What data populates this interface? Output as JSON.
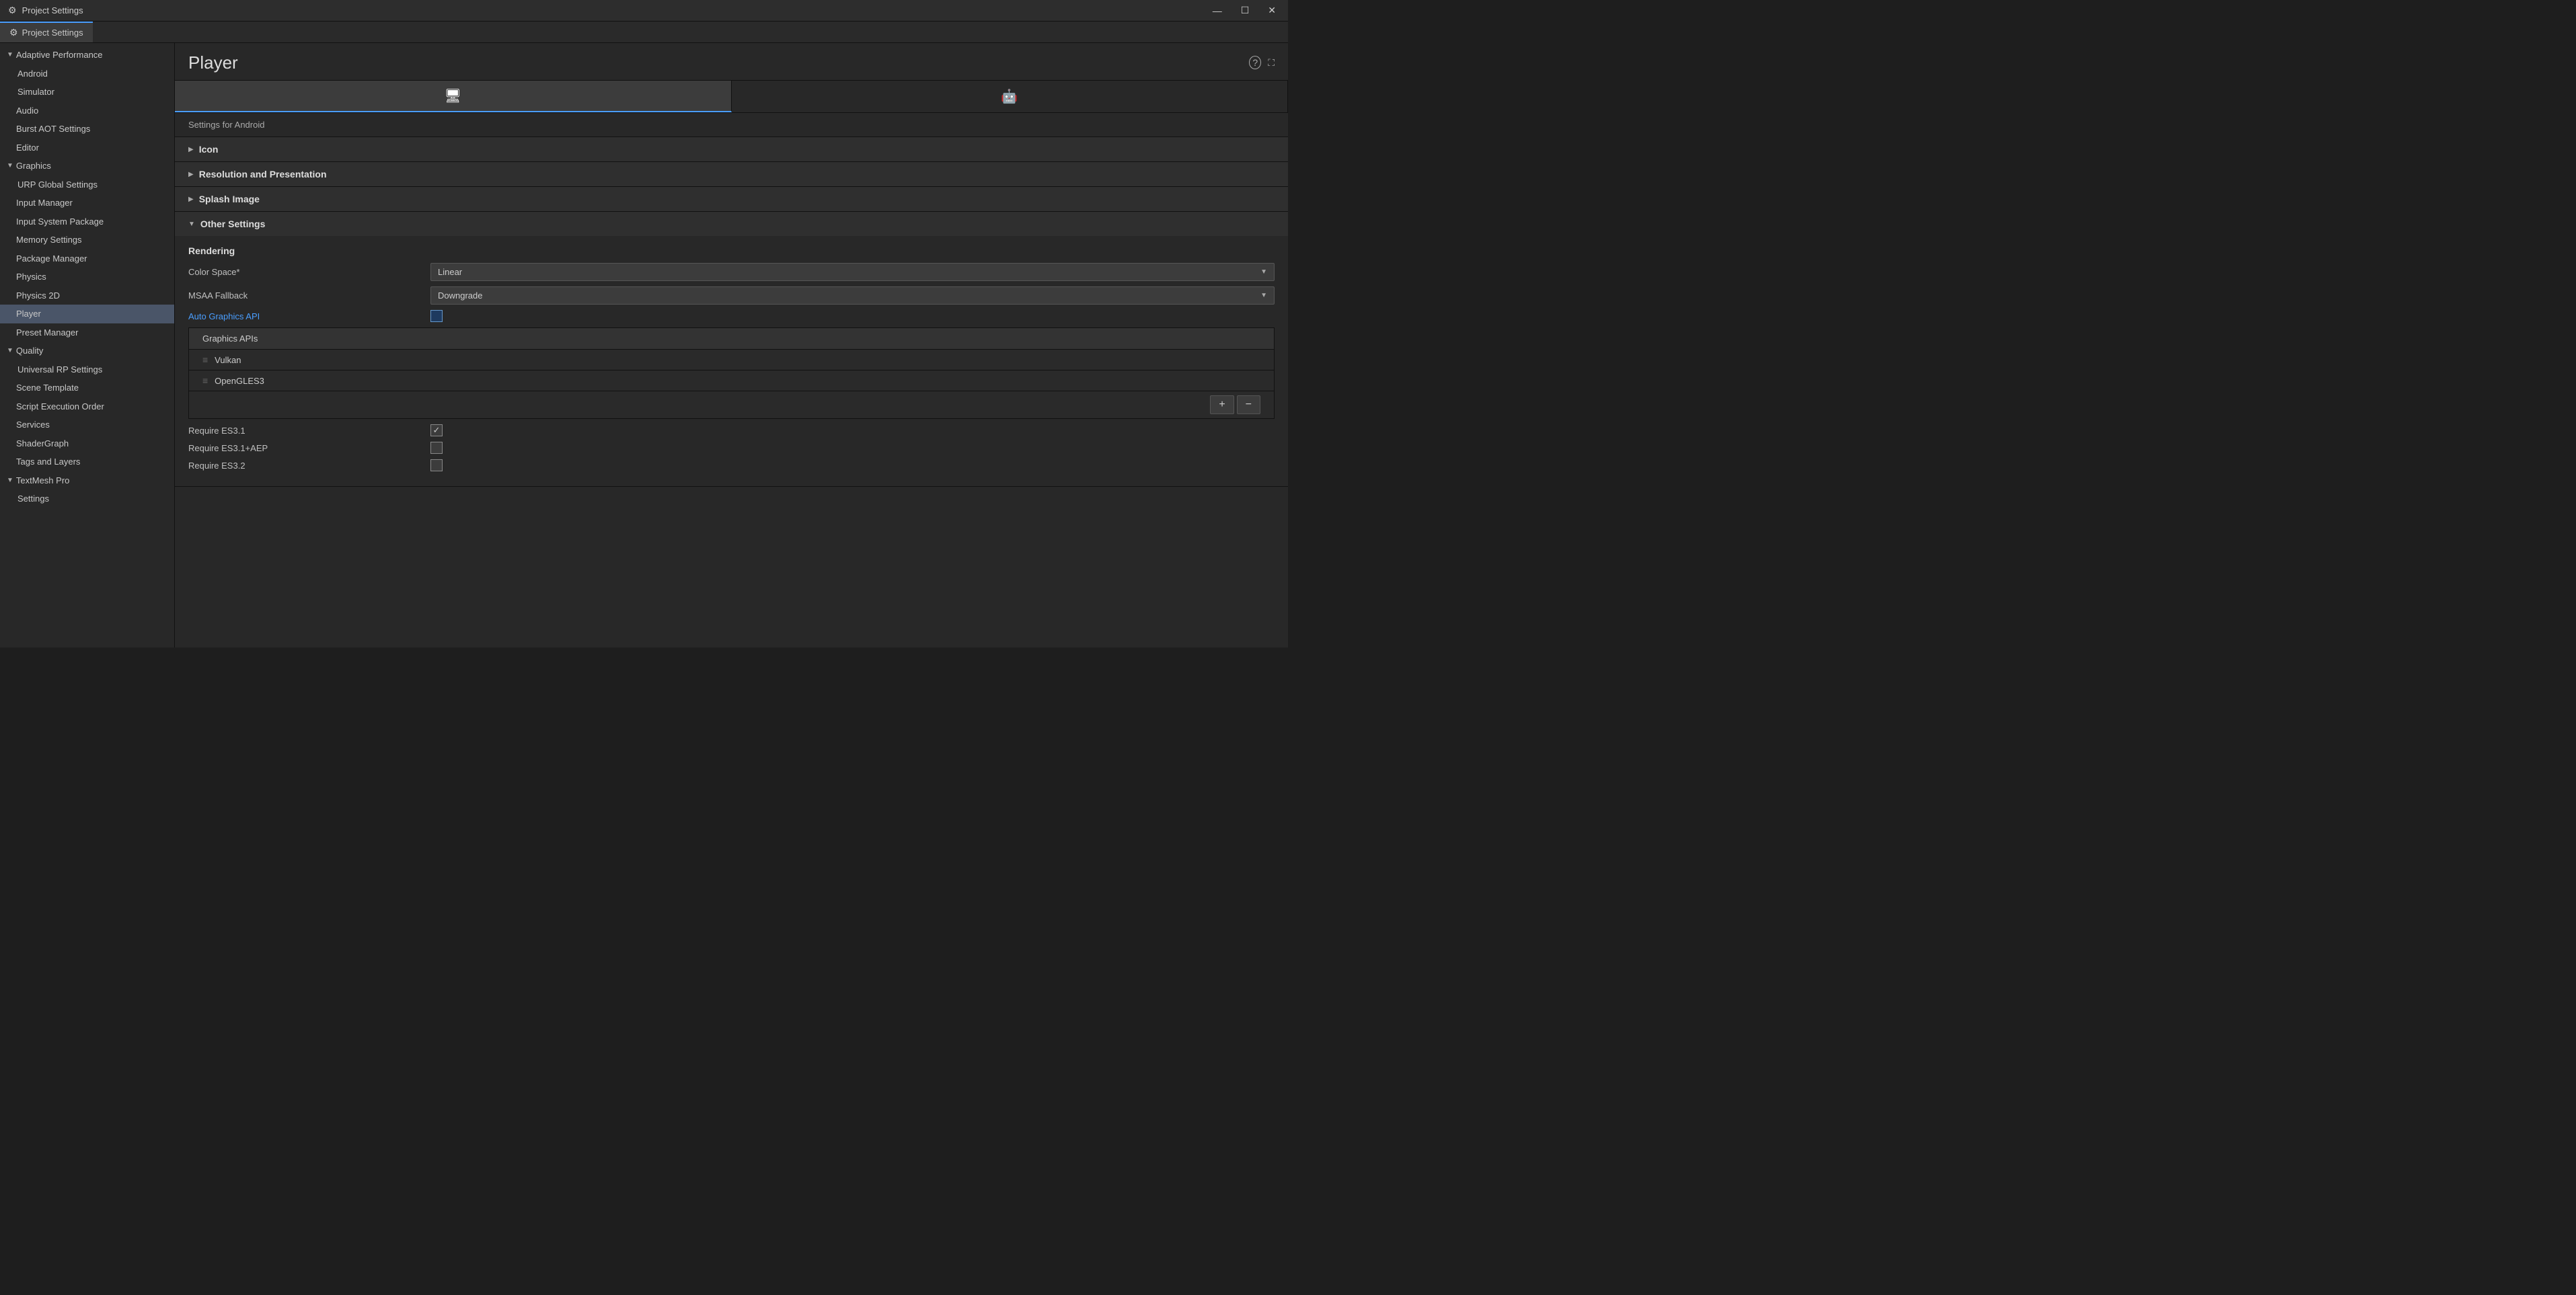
{
  "window": {
    "title": "Project Settings",
    "tab_label": "Project Settings"
  },
  "title_bar": {
    "icon": "gear",
    "title": "Project Settings",
    "minimize": "—",
    "maximize": "☐",
    "close": "✕"
  },
  "sidebar": {
    "items": [
      {
        "id": "adaptive-performance",
        "label": "Adaptive Performance",
        "indent": 0,
        "hasArrow": true,
        "arrowDown": true
      },
      {
        "id": "android",
        "label": "Android",
        "indent": 1
      },
      {
        "id": "simulator",
        "label": "Simulator",
        "indent": 1
      },
      {
        "id": "audio",
        "label": "Audio",
        "indent": 0
      },
      {
        "id": "burst-aot",
        "label": "Burst AOT Settings",
        "indent": 0
      },
      {
        "id": "editor",
        "label": "Editor",
        "indent": 0
      },
      {
        "id": "graphics",
        "label": "Graphics",
        "indent": 0,
        "hasArrow": true,
        "arrowDown": true
      },
      {
        "id": "urp-global",
        "label": "URP Global Settings",
        "indent": 1
      },
      {
        "id": "input-manager",
        "label": "Input Manager",
        "indent": 0
      },
      {
        "id": "input-system",
        "label": "Input System Package",
        "indent": 0
      },
      {
        "id": "memory-settings",
        "label": "Memory Settings",
        "indent": 0
      },
      {
        "id": "package-manager",
        "label": "Package Manager",
        "indent": 0
      },
      {
        "id": "physics",
        "label": "Physics",
        "indent": 0
      },
      {
        "id": "physics-2d",
        "label": "Physics 2D",
        "indent": 0
      },
      {
        "id": "player",
        "label": "Player",
        "indent": 0,
        "active": true
      },
      {
        "id": "preset-manager",
        "label": "Preset Manager",
        "indent": 0
      },
      {
        "id": "quality",
        "label": "Quality",
        "indent": 0,
        "hasArrow": true,
        "arrowDown": true
      },
      {
        "id": "universal-rp",
        "label": "Universal RP Settings",
        "indent": 1
      },
      {
        "id": "scene-template",
        "label": "Scene Template",
        "indent": 0
      },
      {
        "id": "script-execution",
        "label": "Script Execution Order",
        "indent": 0
      },
      {
        "id": "services",
        "label": "Services",
        "indent": 0
      },
      {
        "id": "shader-graph",
        "label": "ShaderGraph",
        "indent": 0
      },
      {
        "id": "tags-layers",
        "label": "Tags and Layers",
        "indent": 0
      },
      {
        "id": "textmesh-pro",
        "label": "TextMesh Pro",
        "indent": 0,
        "hasArrow": true,
        "arrowDown": true
      },
      {
        "id": "textmesh-settings",
        "label": "Settings",
        "indent": 1
      }
    ]
  },
  "content": {
    "title": "Player",
    "platform_tabs": [
      {
        "id": "pc",
        "icon": "monitor",
        "active": true
      },
      {
        "id": "android",
        "icon": "android",
        "active": false
      }
    ],
    "settings_for": "Settings for Android",
    "sections": [
      {
        "id": "icon",
        "title": "Icon",
        "expanded": false
      },
      {
        "id": "resolution",
        "title": "Resolution and Presentation",
        "expanded": false
      },
      {
        "id": "splash",
        "title": "Splash Image",
        "expanded": false
      },
      {
        "id": "other",
        "title": "Other Settings",
        "expanded": true,
        "subsections": [
          {
            "title": "Rendering",
            "fields": [
              {
                "label": "Color Space*",
                "type": "dropdown",
                "value": "Linear",
                "isLink": false
              },
              {
                "label": "MSAA Fallback",
                "type": "dropdown",
                "value": "Downgrade",
                "isLink": false
              },
              {
                "label": "Auto Graphics API",
                "type": "checkbox",
                "checked": false,
                "isLink": true
              }
            ],
            "graphics_apis": {
              "title": "Graphics APIs",
              "items": [
                "Vulkan",
                "OpenGLES3"
              ],
              "buttons": [
                "+",
                "−"
              ]
            },
            "extra_fields": [
              {
                "label": "Require ES3.1",
                "type": "checkbox",
                "checked": true
              },
              {
                "label": "Require ES3.1+AEP",
                "type": "checkbox",
                "checked": false
              },
              {
                "label": "Require ES3.2",
                "type": "checkbox",
                "checked": false
              }
            ]
          }
        ]
      }
    ]
  }
}
